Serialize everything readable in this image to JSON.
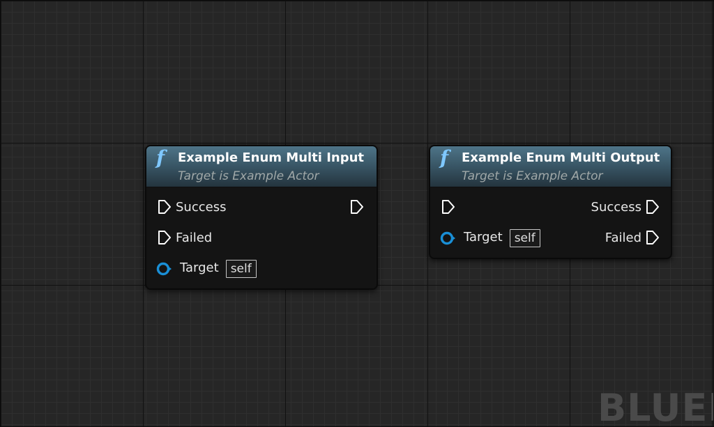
{
  "graph": {
    "watermark": "BLUEPR"
  },
  "nodes": [
    {
      "title": "Example Enum Multi Input",
      "subtitle": "Target is Example Actor",
      "icon": "function-icon",
      "pins": {
        "exec_in_label": "Success",
        "exec_in2_label": "Failed",
        "target_label": "Target",
        "target_value": "self"
      }
    },
    {
      "title": "Example Enum Multi Output",
      "subtitle": "Target is Example Actor",
      "icon": "function-icon",
      "pins": {
        "exec_out_label": "Success",
        "exec_out2_label": "Failed",
        "target_label": "Target",
        "target_value": "self"
      }
    }
  ],
  "colors": {
    "exec_pin": "#ffffff",
    "object_pin": "#1a8fd6",
    "header_accent": "#4e7488"
  }
}
